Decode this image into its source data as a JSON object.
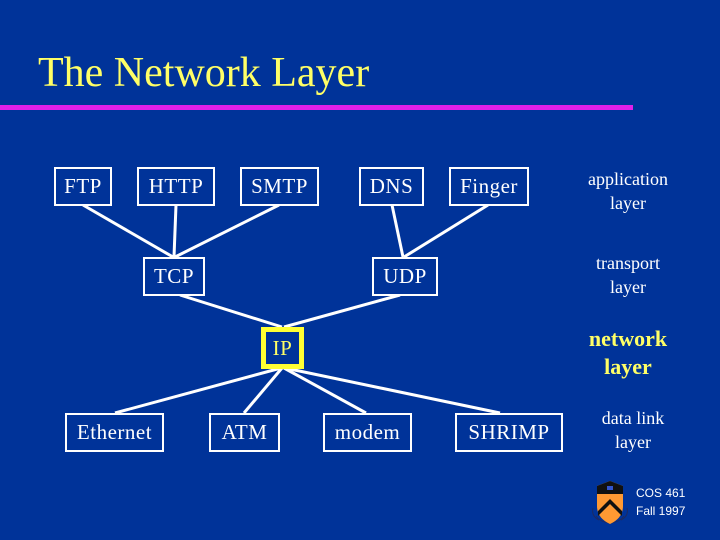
{
  "slide": {
    "title": "The Network Layer",
    "colors": {
      "background": "#003399",
      "title": "#ffff66",
      "rule": "#e020e8",
      "box": "#ffffff",
      "highlight": "#ffff33"
    }
  },
  "diagram": {
    "application": [
      "FTP",
      "HTTP",
      "SMTP",
      "DNS",
      "Finger"
    ],
    "transport": [
      "TCP",
      "UDP"
    ],
    "network": [
      "IP"
    ],
    "datalink": [
      "Ethernet",
      "ATM",
      "modem",
      "SHRIMP"
    ],
    "edges": [
      [
        "FTP",
        "TCP"
      ],
      [
        "HTTP",
        "TCP"
      ],
      [
        "SMTP",
        "TCP"
      ],
      [
        "DNS",
        "UDP"
      ],
      [
        "Finger",
        "UDP"
      ],
      [
        "TCP",
        "IP"
      ],
      [
        "UDP",
        "IP"
      ],
      [
        "IP",
        "Ethernet"
      ],
      [
        "IP",
        "ATM"
      ],
      [
        "IP",
        "modem"
      ],
      [
        "IP",
        "SHRIMP"
      ]
    ],
    "highlighted": "IP"
  },
  "layers": {
    "application": [
      "application",
      "layer"
    ],
    "transport": [
      "transport",
      "layer"
    ],
    "network": [
      "network",
      "layer"
    ],
    "datalink": [
      "data link",
      "layer"
    ]
  },
  "footer": {
    "course": "COS 461",
    "term": "Fall 1997",
    "logo": "princeton-shield-icon"
  }
}
